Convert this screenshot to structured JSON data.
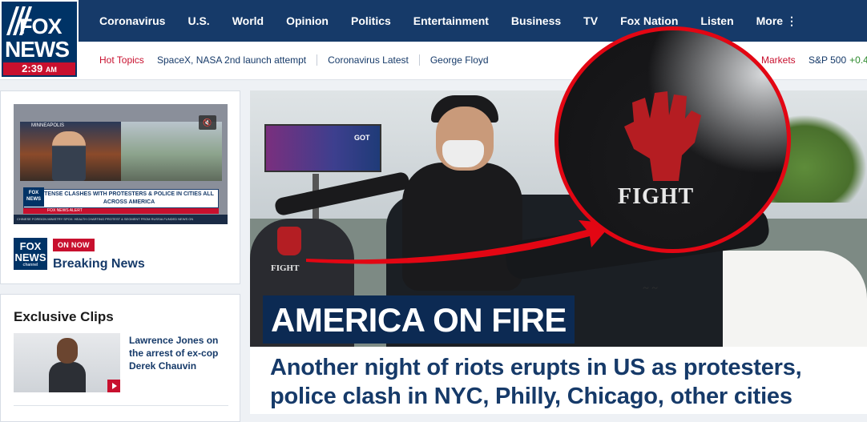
{
  "logo": {
    "line1": "FOX",
    "line2": "NEWS",
    "time": "2:39",
    "ampm": "AM"
  },
  "nav": {
    "items": [
      "Coronavirus",
      "U.S.",
      "World",
      "Opinion",
      "Politics",
      "Entertainment",
      "Business",
      "TV",
      "Fox Nation",
      "Listen",
      "More ⋮"
    ]
  },
  "subnav": {
    "hot_label": "Hot Topics",
    "links": [
      "SpaceX, NASA 2nd launch attempt",
      "Coronavirus Latest",
      "George Floyd"
    ],
    "markets_label": "Markets",
    "index_name": "S&P 500",
    "index_change": "+0.4"
  },
  "video": {
    "location": "MINNEAPOLIS",
    "chyron": "TENSE CLASHES WITH PROTESTERS & POLICE IN CITIES ALL ACROSS AMERICA",
    "alert": "FOX NEWS ALERT",
    "ticker": "CHINESE FOREIGN MINISTRY SPOX: HEALTH CHARTING PROTEST & SEGMENT FROM RUSSIA FUNDED NEWS ON",
    "mute_icon": "mute-icon"
  },
  "channel": {
    "logo_line1": "FOX",
    "logo_line2": "NEWS",
    "logo_line3": "channel",
    "on_now": "ON NOW",
    "show": "Breaking News"
  },
  "clips": {
    "title": "Exclusive Clips",
    "items": [
      {
        "text": "Lawrence Jones on the arrest of ex-cop Derek Chauvin"
      }
    ]
  },
  "hero": {
    "billboard_text": "GOT",
    "fist_caption": "FIGHT",
    "zoom_caption": "FIGHT",
    "headline": "AMERICA ON FIRE",
    "subheadline": "Another night of riots erupts in US as protesters, police clash in NYC, Philly, Chicago, other cities",
    "accent": "#e30613"
  },
  "colors": {
    "nav_bg": "#163a69",
    "brand_red": "#c8102e",
    "link_blue": "#163a69"
  }
}
